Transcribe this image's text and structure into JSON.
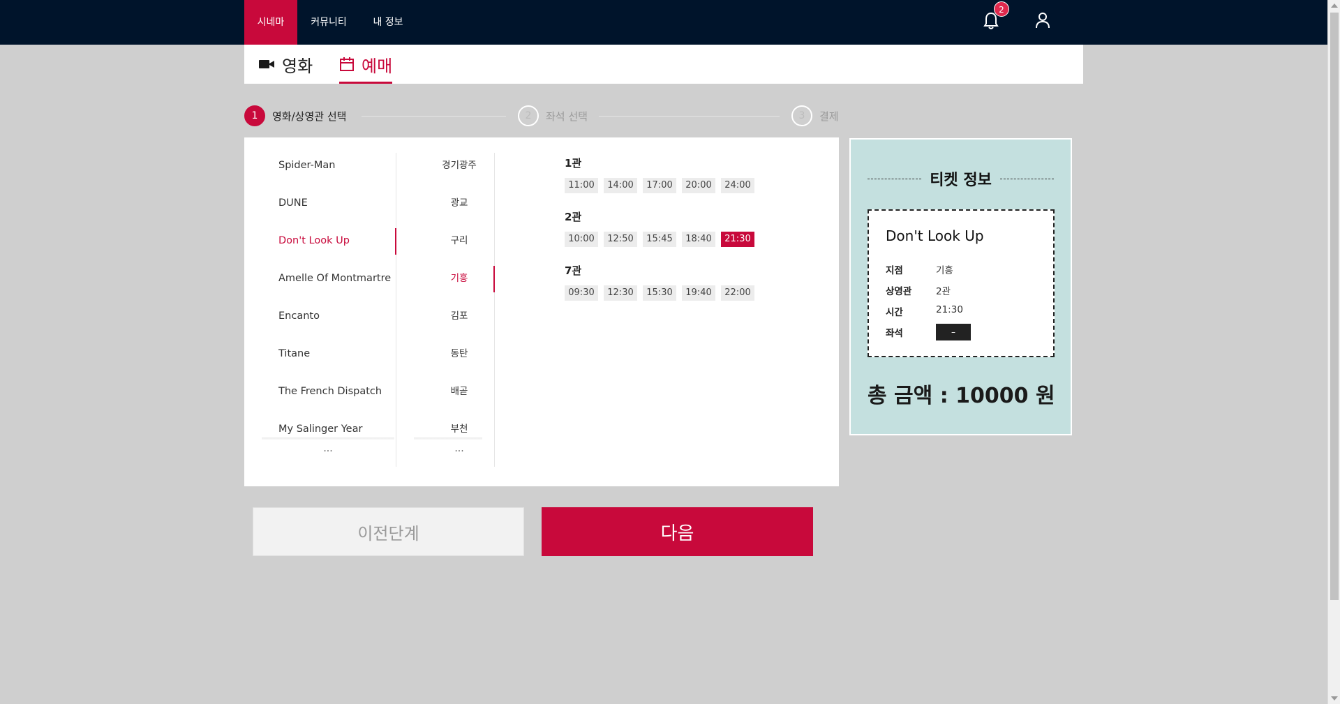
{
  "nav": {
    "items": [
      {
        "label": "시네마",
        "active": true
      },
      {
        "label": "커뮤니티",
        "active": false
      },
      {
        "label": "내 정보",
        "active": false
      }
    ],
    "notification_count": "2"
  },
  "tabs": [
    {
      "label": "영화",
      "icon": "video-camera-icon",
      "active": false
    },
    {
      "label": "예매",
      "icon": "calendar-icon",
      "active": true
    }
  ],
  "steps": [
    {
      "num": "1",
      "label": "영화/상영관 선택",
      "active": true
    },
    {
      "num": "2",
      "label": "좌석 선택",
      "active": false
    },
    {
      "num": "3",
      "label": "결제",
      "active": false
    }
  ],
  "movies": {
    "items": [
      "Spider-Man",
      "DUNE",
      "Don't Look Up",
      "Amelle Of Montmartre",
      "Encanto",
      "Titane",
      "The French Dispatch",
      "My Salinger Year"
    ],
    "selected": "Don't Look Up",
    "more": "..."
  },
  "regions": {
    "items": [
      "경기광주",
      "광교",
      "구리",
      "기흥",
      "김포",
      "동탄",
      "배곧",
      "부천"
    ],
    "selected": "기흥",
    "more": "..."
  },
  "halls": [
    {
      "name": "1관",
      "times": [
        "11:00",
        "14:00",
        "17:00",
        "20:00",
        "24:00"
      ]
    },
    {
      "name": "2관",
      "times": [
        "10:00",
        "12:50",
        "15:45",
        "18:40",
        "21:30"
      ],
      "selected": "21:30"
    },
    {
      "name": "7관",
      "times": [
        "09:30",
        "12:30",
        "15:30",
        "19:40",
        "22:00"
      ]
    }
  ],
  "ticket": {
    "heading": "티켓 정보",
    "movie": "Don't Look Up",
    "rows": [
      {
        "label": "지점",
        "value": "기흥"
      },
      {
        "label": "상영관",
        "value": "2관"
      },
      {
        "label": "시간",
        "value": "21:30"
      },
      {
        "label": "좌석",
        "value": "–"
      }
    ],
    "total": "총 금액 : 10000 원"
  },
  "buttons": {
    "prev": "이전단계",
    "next": "다음"
  },
  "colors": {
    "accent": "#c8093b",
    "nav_bg": "#00142b",
    "ticket_bg": "#c4e0df"
  }
}
